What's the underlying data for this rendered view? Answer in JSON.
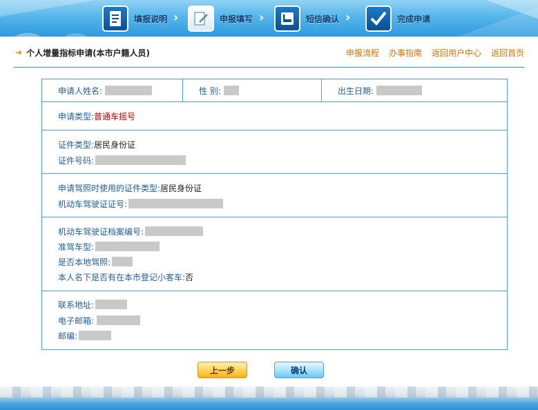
{
  "steps": [
    {
      "label": "填报说明",
      "icon": "document-icon"
    },
    {
      "label": "申报填写",
      "icon": "edit-form-icon"
    },
    {
      "label": "短信确认",
      "icon": "sms-phone-icon"
    },
    {
      "label": "完成申请",
      "icon": "checkmark-icon"
    }
  ],
  "header": {
    "title": "个人增量指标申请(本市户籍人员)",
    "links": [
      "申报流程",
      "办事指南",
      "返回用户中心",
      "返回首页"
    ]
  },
  "form": {
    "applicant_name_label": "申请人姓名:",
    "gender_label": "性 别:",
    "birth_date_label": "出生日期:",
    "apply_type_label": "申请类型:",
    "apply_type_value": "普通车摇号",
    "id_type_label": "证件类型:",
    "id_type_value": "居民身份证",
    "id_number_label": "证件号码:",
    "license_id_type_label": "申请驾照时使用的证件类型:",
    "license_id_type_value": "居民身份证",
    "license_number_label": "机动车驾驶证证号:",
    "license_file_label": "机动车驾驶证档案编号:",
    "vehicle_class_label": "准驾车型:",
    "local_license_label": "是否本地驾照:",
    "has_car_label": "本人名下是否有在本市登记小客车:",
    "has_car_value": "否",
    "address_label": "联系地址:",
    "email_label": "电子邮箱:",
    "postcode_label": "邮编:"
  },
  "buttons": {
    "prev": "上一步",
    "confirm": "确认"
  },
  "colors": {
    "accent_blue": "#2f8fcf",
    "label_blue": "#1d5f9c",
    "link_orange": "#e07000",
    "highlight_red": "#cc0000"
  }
}
